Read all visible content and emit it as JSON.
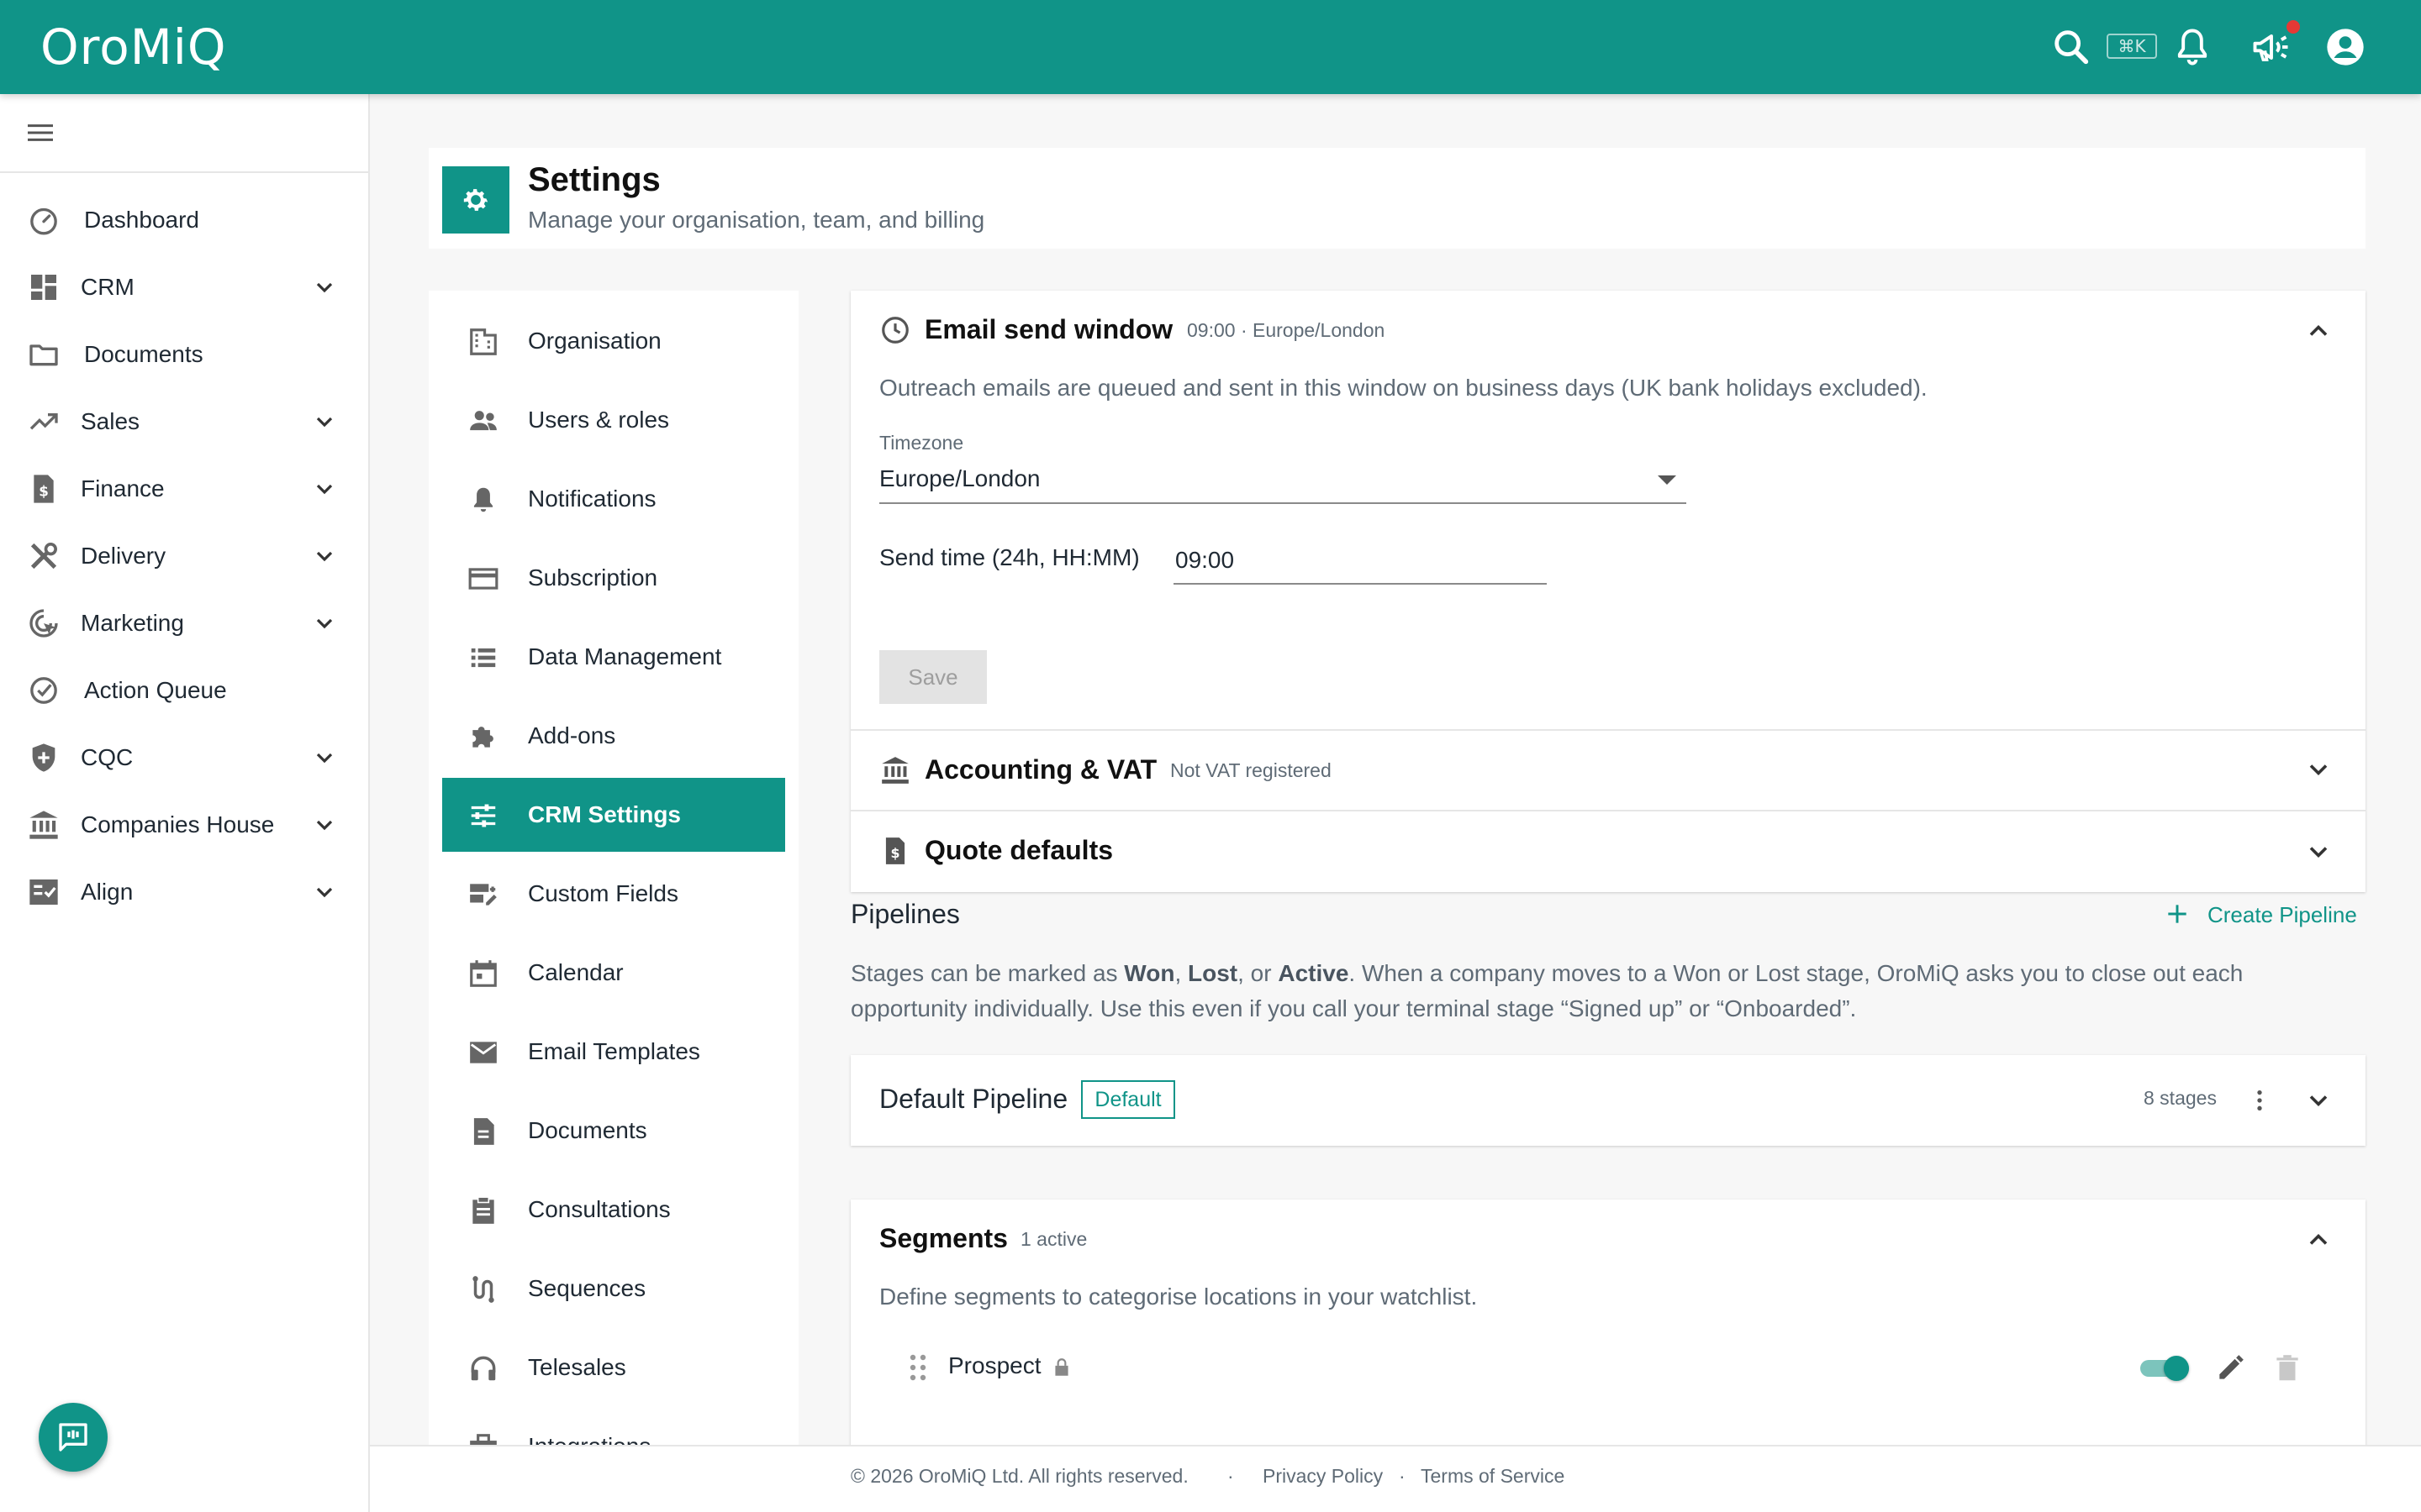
{
  "app": {
    "logo": "OroMiQ",
    "search_shortcut": "⌘K"
  },
  "colors": {
    "brand": "#109488",
    "notification_dot": "#e53935"
  },
  "topbar": {
    "icons": [
      "search-icon",
      "bell-icon",
      "megaphone-icon",
      "account-circle-icon"
    ]
  },
  "sidebar": {
    "items": [
      {
        "label": "Dashboard",
        "icon": "speedometer-icon",
        "expandable": false
      },
      {
        "label": "CRM",
        "icon": "dashboard-grid-icon",
        "expandable": true
      },
      {
        "label": "Documents",
        "icon": "folder-icon",
        "expandable": false
      },
      {
        "label": "Sales",
        "icon": "trending-up-icon",
        "expandable": true
      },
      {
        "label": "Finance",
        "icon": "invoice-icon",
        "expandable": true
      },
      {
        "label": "Delivery",
        "icon": "tools-icon",
        "expandable": true
      },
      {
        "label": "Marketing",
        "icon": "target-cursor-icon",
        "expandable": true
      },
      {
        "label": "Action Queue",
        "icon": "check-circle-icon",
        "expandable": false
      },
      {
        "label": "CQC",
        "icon": "shield-icon",
        "expandable": true
      },
      {
        "label": "Companies House",
        "icon": "bank-icon",
        "expandable": true
      },
      {
        "label": "Align",
        "icon": "checklist-icon",
        "expandable": true
      }
    ]
  },
  "header": {
    "title": "Settings",
    "subtitle": "Manage your organisation, team, and billing"
  },
  "settings_nav": {
    "active": "CRM Settings",
    "items": [
      {
        "label": "Organisation",
        "icon": "building-icon"
      },
      {
        "label": "Users & roles",
        "icon": "people-icon"
      },
      {
        "label": "Notifications",
        "icon": "bell-icon"
      },
      {
        "label": "Subscription",
        "icon": "credit-card-icon"
      },
      {
        "label": "Data Management",
        "icon": "list-icon"
      },
      {
        "label": "Add-ons",
        "icon": "puzzle-icon"
      },
      {
        "label": "CRM Settings",
        "icon": "sliders-icon"
      },
      {
        "label": "Custom Fields",
        "icon": "custom-fields-icon"
      },
      {
        "label": "Calendar",
        "icon": "calendar-icon"
      },
      {
        "label": "Email Templates",
        "icon": "mail-icon"
      },
      {
        "label": "Documents",
        "icon": "document-icon"
      },
      {
        "label": "Consultations",
        "icon": "clipboard-icon"
      },
      {
        "label": "Sequences",
        "icon": "route-icon"
      },
      {
        "label": "Telesales",
        "icon": "headset-icon"
      },
      {
        "label": "Integrations",
        "icon": "briefcase-icon"
      }
    ]
  },
  "email_window": {
    "title": "Email send window",
    "meta": "09:00 · Europe/London",
    "description": "Outreach emails are queued and sent in this window on business days (UK bank holidays excluded).",
    "timezone_label": "Timezone",
    "timezone_value": "Europe/London",
    "send_time_label": "Send time (24h, HH:MM)",
    "send_time_value": "09:00",
    "save_label": "Save"
  },
  "accounting": {
    "title": "Accounting & VAT",
    "meta": "Not VAT registered"
  },
  "quote_defaults": {
    "title": "Quote defaults"
  },
  "pipelines": {
    "heading": "Pipelines",
    "create_label": "Create Pipeline",
    "description": {
      "p1": "Stages can be marked as ",
      "won": "Won",
      "p2": ", ",
      "lost": "Lost",
      "p3": ", or ",
      "active": "Active",
      "p4": ". When a company moves to a Won or Lost stage, OroMiQ asks you to close out each opportunity individually. Use this even if you call your terminal stage “Signed up” or “Onboarded”."
    },
    "default_pipeline": {
      "name": "Default Pipeline",
      "badge": "Default",
      "stages": "8 stages"
    }
  },
  "segments": {
    "title": "Segments",
    "meta": "1 active",
    "description": "Define segments to categorise locations in your watchlist.",
    "items": [
      {
        "name": "Prospect",
        "locked": true,
        "enabled": true
      }
    ]
  },
  "footer": {
    "copyright": "© 2026 OroMiQ Ltd. All rights reserved.",
    "separator": "·",
    "privacy": "Privacy Policy",
    "terms": "Terms of Service"
  }
}
